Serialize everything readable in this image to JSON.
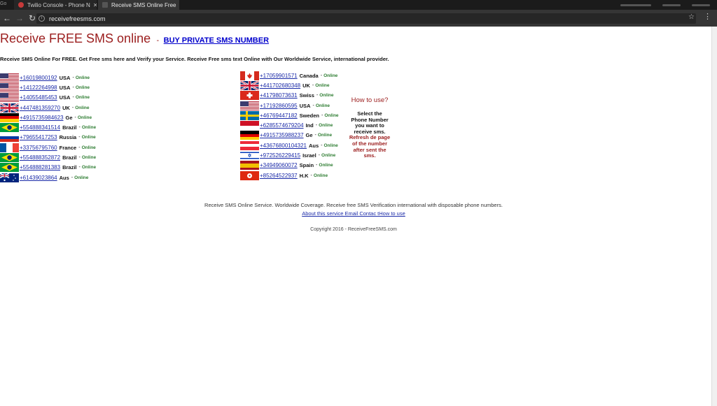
{
  "tabs": [
    {
      "label": "Twilio Console - Phone N"
    },
    {
      "label": "Receive SMS Online Free"
    }
  ],
  "tabbar_left": "Go",
  "url": "receivefreesms.com",
  "header": {
    "title": "Receive FREE SMS online",
    "separator": "-",
    "buy_link": "BUY PRIVATE SMS NUMBER"
  },
  "intro": "Receive SMS Online For FREE. Get Free sms here and Verify your Service. Receive Free sms text Online with Our Worldwide Service, international provider.",
  "status_online": "Online",
  "dash": "-",
  "left_numbers": [
    {
      "number": "+16019800192",
      "country": "USA",
      "flag": "us"
    },
    {
      "number": "+14122264998",
      "country": "USA",
      "flag": "us"
    },
    {
      "number": "+14055485453",
      "country": "USA",
      "flag": "us"
    },
    {
      "number": "+447481359270",
      "country": "UK",
      "flag": "uk"
    },
    {
      "number": "+4915735984623",
      "country": "Ge",
      "flag": "de"
    },
    {
      "number": "+554888341514",
      "country": "Brazil",
      "flag": "br"
    },
    {
      "number": "+79655417253",
      "country": "Russia",
      "flag": "ru"
    },
    {
      "number": "+33756795760",
      "country": "France",
      "flag": "fr"
    },
    {
      "number": "+554888352872",
      "country": "Brazil",
      "flag": "br"
    },
    {
      "number": "+554888281383",
      "country": "Brazil",
      "flag": "br"
    },
    {
      "number": "+61439023864",
      "country": "Aus",
      "flag": "au"
    }
  ],
  "right_numbers": [
    {
      "number": "+17059901571",
      "country": "Canada",
      "flag": "ca"
    },
    {
      "number": "+441702680348",
      "country": "UK",
      "flag": "uk"
    },
    {
      "number": "+41798073631",
      "country": "Swiss",
      "flag": "ch"
    },
    {
      "number": "+17192860595",
      "country": "USA",
      "flag": "us"
    },
    {
      "number": "+46769447182",
      "country": "Sweden",
      "flag": "se"
    },
    {
      "number": "+6285574679204",
      "country": "Ind",
      "flag": "id"
    },
    {
      "number": "+4915735988237",
      "country": "Ge",
      "flag": "de"
    },
    {
      "number": "+43676800104321",
      "country": "Aus",
      "flag": "at"
    },
    {
      "number": "+972526229415",
      "country": "Israel",
      "flag": "il"
    },
    {
      "number": "+34949060072",
      "country": "Spain",
      "flag": "es"
    },
    {
      "number": "+85264522937",
      "country": "H.K",
      "flag": "hk"
    }
  ],
  "howto": {
    "title": "How to use?",
    "lines_black": [
      "Select the",
      "Phone Number",
      "you want to",
      "receive sms."
    ],
    "lines_red": [
      "Refresh de page",
      "of the number",
      "after sent the",
      "sms."
    ]
  },
  "footer": {
    "text": "Receive SMS Online Service. Worldwide Coverage. Receive free SMS Verification international with disposable phone numbers.",
    "links": "About this service Email Contac tHow to use",
    "copyright": "Copyright 2016 - ReceiveFreeSMS.com"
  },
  "colors": {
    "title_red": "#9b1d1d",
    "link_blue": "#1a2aa8",
    "online_green": "#2e7d32",
    "chrome_dark": "#353535"
  }
}
